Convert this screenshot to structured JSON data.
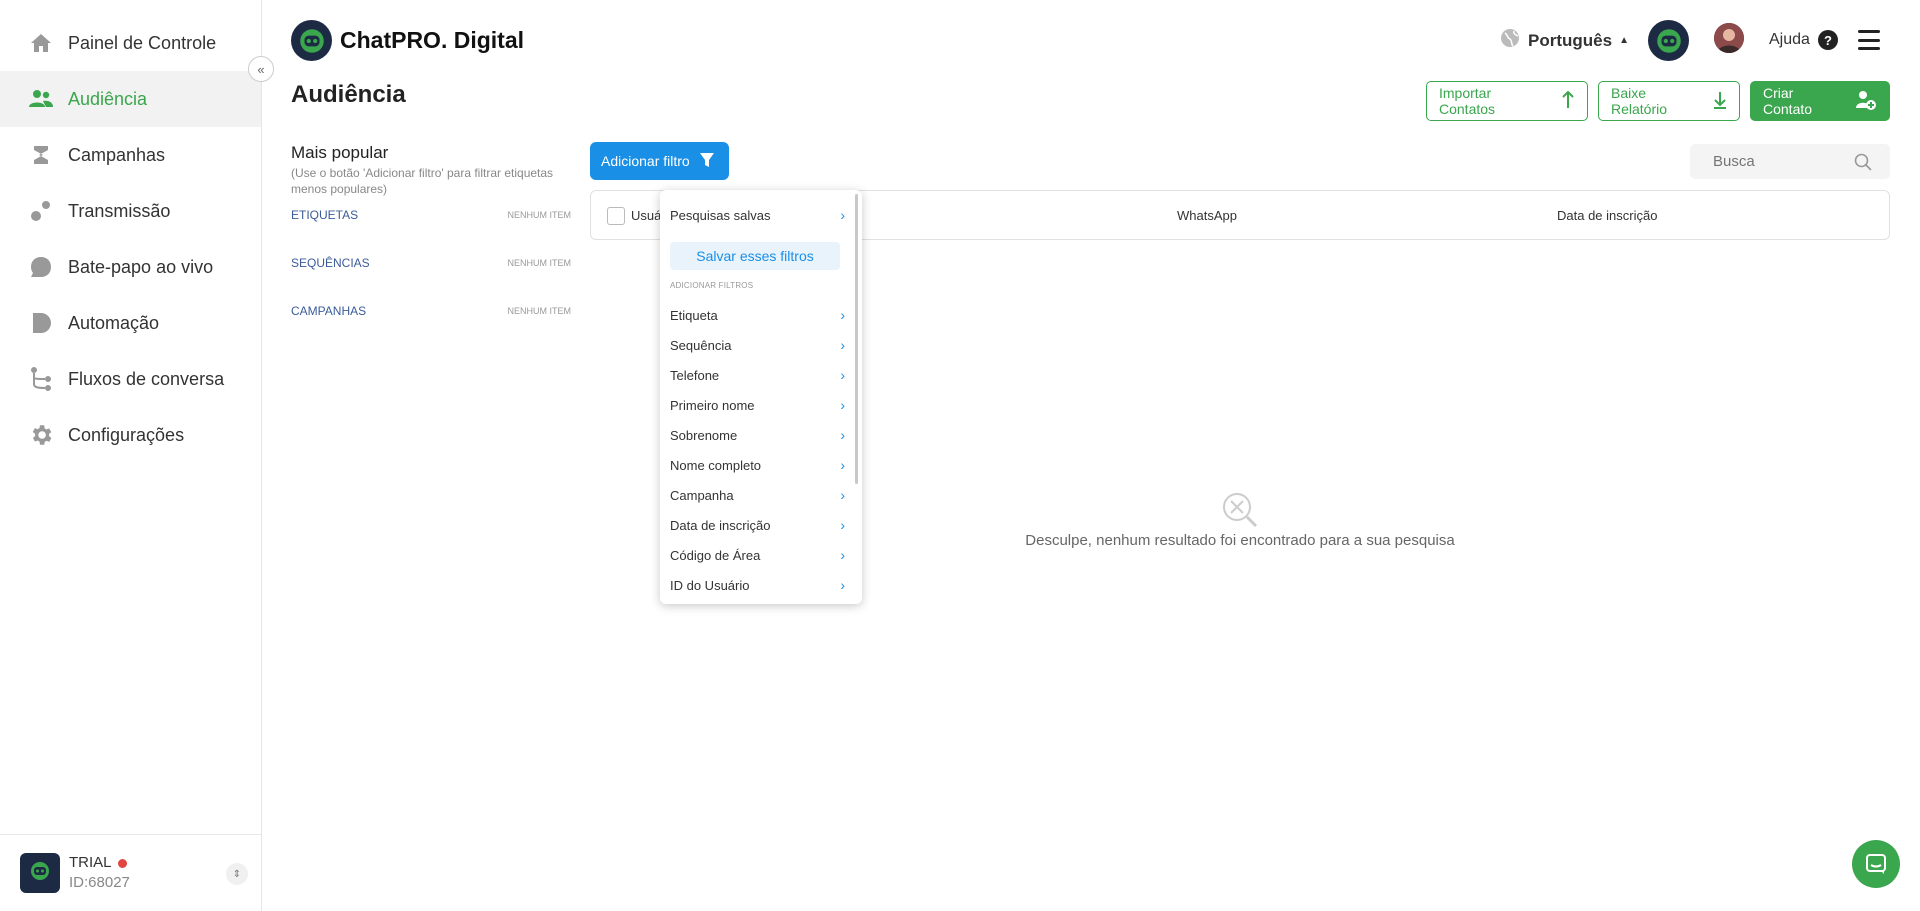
{
  "sidebar": {
    "items": [
      {
        "label": "Painel de Controle",
        "icon": "home-icon"
      },
      {
        "label": "Audiência",
        "icon": "users-icon",
        "active": true
      },
      {
        "label": "Campanhas",
        "icon": "campaigns-icon"
      },
      {
        "label": "Transmissão",
        "icon": "broadcast-icon"
      },
      {
        "label": "Bate-papo ao vivo",
        "icon": "chat-icon"
      },
      {
        "label": "Automação",
        "icon": "automation-icon"
      },
      {
        "label": "Fluxos de conversa",
        "icon": "flows-icon"
      },
      {
        "label": "Configurações",
        "icon": "gear-icon"
      }
    ],
    "footer": {
      "plan": "TRIAL",
      "account_id": "ID:68027"
    }
  },
  "header": {
    "brand": "ChatPRO. Digital",
    "language": "Português",
    "help": "Ajuda"
  },
  "page": {
    "title": "Audiência",
    "actions": {
      "import": "Importar Contatos",
      "report": "Baixe Relatório",
      "create": "Criar Contato"
    }
  },
  "filters": {
    "title": "Mais popular",
    "hint": "(Use o botão 'Adicionar filtro' para filtrar etiquetas menos populares)",
    "groups": [
      {
        "name": "ETIQUETAS",
        "empty": "NENHUM ITEM"
      },
      {
        "name": "SEQUÊNCIAS",
        "empty": "NENHUM ITEM"
      },
      {
        "name": "CAMPANHAS",
        "empty": "NENHUM ITEM"
      }
    ],
    "add_button": "Adicionar filtro"
  },
  "search": {
    "placeholder": "Busca"
  },
  "table": {
    "columns": [
      "Usuá",
      "WhatsApp",
      "Data de inscrição"
    ],
    "empty_message": "Desculpe, nenhum resultado foi encontrado para a sua pesquisa"
  },
  "dropdown": {
    "saved_searches": "Pesquisas salvas",
    "save_filters": "Salvar esses filtros",
    "section_label": "ADICIONAR FILTROS",
    "items": [
      "Etiqueta",
      "Sequência",
      "Telefone",
      "Primeiro nome",
      "Sobrenome",
      "Nome completo",
      "Campanha",
      "Data de inscrição",
      "Código de Área",
      "ID do Usuário"
    ]
  },
  "colors": {
    "accent_green": "#3aa64d",
    "accent_blue": "#1a8fe6",
    "brand_navy": "#1d2a44"
  }
}
